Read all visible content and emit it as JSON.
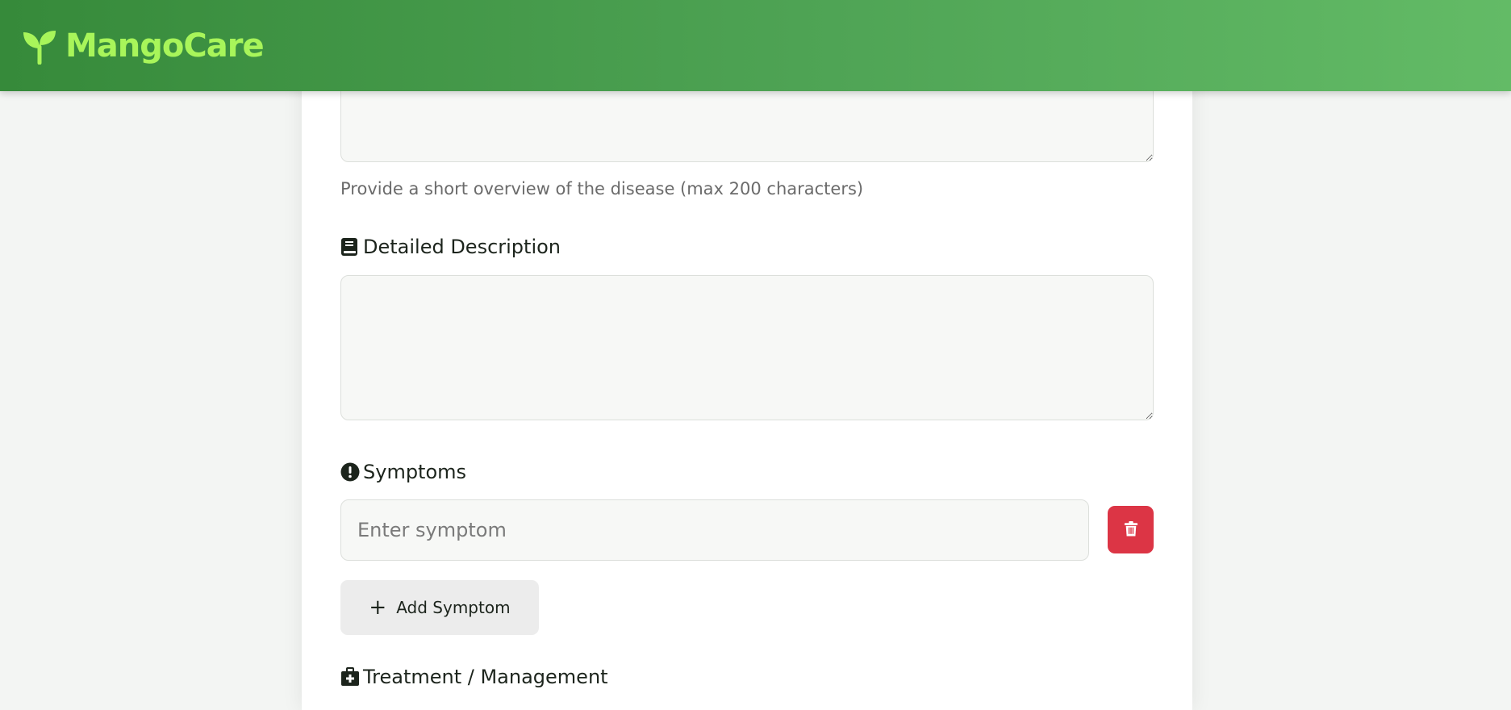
{
  "header": {
    "brand": "MangoCare",
    "brand_icon": "seedling-icon",
    "brand_color": "#a8f55a"
  },
  "form": {
    "summary": {
      "value": "",
      "hint": "Provide a short overview of the disease (max 200 characters)"
    },
    "detailed_description": {
      "label": "Detailed Description",
      "icon": "book-icon",
      "value": ""
    },
    "symptoms": {
      "label": "Symptoms",
      "icon": "exclamation-circle-icon",
      "items": [
        {
          "value": "",
          "placeholder": "Enter symptom",
          "delete_icon": "trash-icon"
        }
      ],
      "add_label": "Add Symptom",
      "add_icon": "plus-icon"
    },
    "treatment": {
      "label": "Treatment / Management",
      "icon": "medkit-icon"
    }
  },
  "colors": {
    "header_start": "#368a3a",
    "header_end": "#63bb66",
    "danger": "#dc3545"
  }
}
